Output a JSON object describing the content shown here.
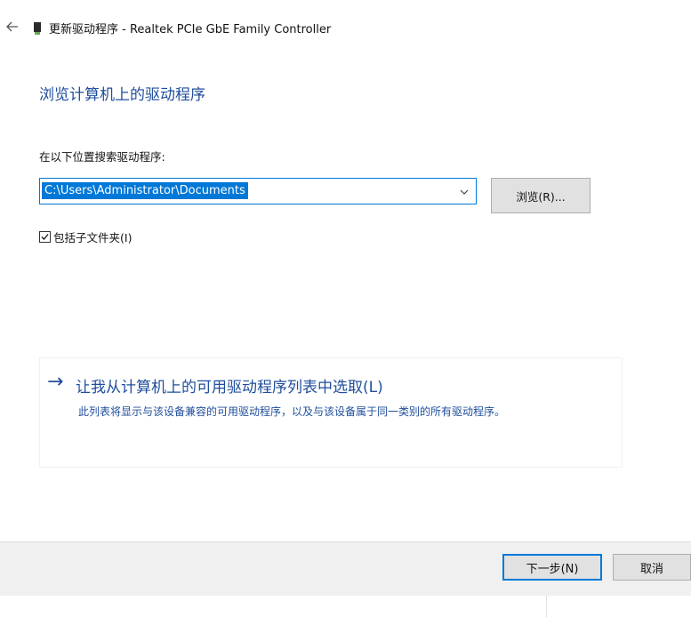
{
  "window": {
    "title": "更新驱动程序 - Realtek PCIe GbE Family Controller"
  },
  "icons": {
    "back": "back-arrow-icon",
    "device": "network-device-icon",
    "dropdown": "chevron-down-icon",
    "link_arrow": "arrow-right-icon",
    "checkbox": "checkmark-icon"
  },
  "main": {
    "heading": "浏览计算机上的驱动程序",
    "search_label": "在以下位置搜索驱动程序:",
    "path_value": "C:\\Users\\Administrator\\Documents",
    "browse_label": "浏览(R)...",
    "include_subfolders": {
      "label": "包括子文件夹(I)",
      "checked": true
    }
  },
  "pick_from_list": {
    "arrow": "→",
    "title": "让我从计算机上的可用驱动程序列表中选取(L)",
    "description": "此列表将显示与该设备兼容的可用驱动程序，以及与该设备属于同一类别的所有驱动程序。"
  },
  "footer": {
    "next_label": "下一步(N)",
    "cancel_label": "取消"
  },
  "colors": {
    "accent": "#0078d7",
    "link": "#1f4e9c",
    "footer_bg": "#f0f0f0",
    "button_bg": "#e1e1e1"
  }
}
